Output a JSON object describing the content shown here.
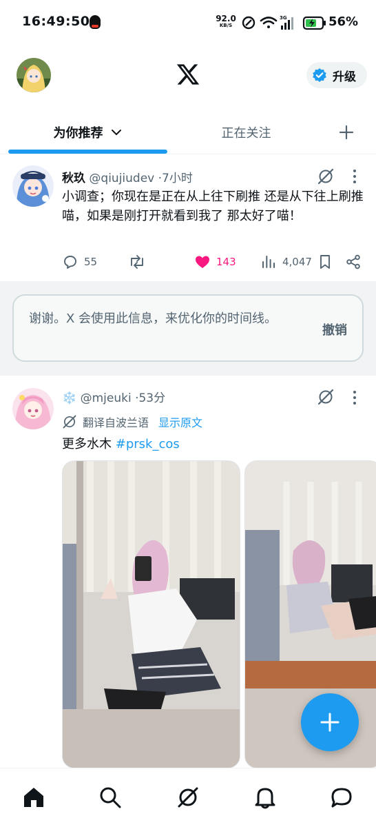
{
  "status_bar": {
    "time": "16:49:50",
    "net_speed_value": "92.0",
    "net_speed_unit": "KB/S",
    "battery_percent": "56%",
    "icons": [
      "qq-icon",
      "alarm-icon",
      "wifi-icon",
      "signal-icon",
      "battery-icon"
    ]
  },
  "header": {
    "logo": "x-logo-icon",
    "upgrade_label": "升级"
  },
  "tabs": [
    {
      "label": "为你推荐",
      "selected": true
    },
    {
      "label": "正在关注",
      "selected": false
    }
  ],
  "tweet1": {
    "name": "秋玖",
    "handle": "@qiujiudev",
    "separator": "·",
    "time": "7小时",
    "text": "小调查；你现在是正在从上往下刷推 还是从下往上刷推喵，如果是刚打开就看到我了 那太好了喵！",
    "replies": "55",
    "likes": "143",
    "views": "4,047"
  },
  "feedback_notice": {
    "text": "谢谢。X 会使用此信息，来优化你的时间线。",
    "undo_label": "撤销"
  },
  "tweet2": {
    "name_emoji": "❄️",
    "handle": "@mjeuki",
    "separator": "·",
    "time": "53分",
    "translated_label": "翻译自波兰语",
    "show_original_label": "显示原文",
    "text": "更多水木",
    "hashtag": "#prsk_cos"
  },
  "colors": {
    "accent": "#1d9bf0",
    "like": "#f91880",
    "secondary_text": "#536471"
  },
  "bottom_nav": [
    "home-icon",
    "search-icon",
    "grok-icon",
    "notifications-icon",
    "messages-icon"
  ]
}
